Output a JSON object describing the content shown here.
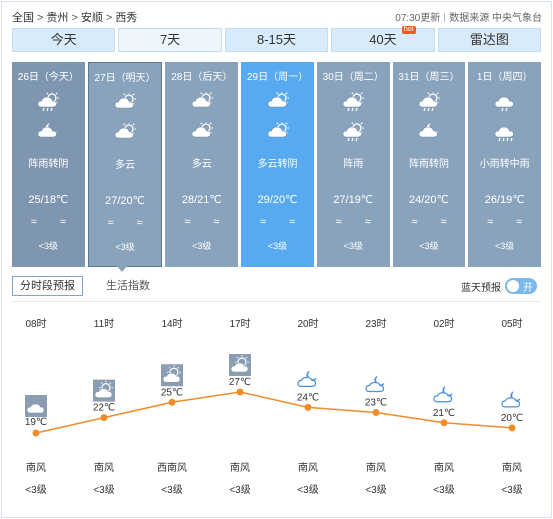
{
  "breadcrumb": {
    "items": [
      "全国",
      "贵州",
      "安顺",
      "西秀"
    ],
    "separator": ">"
  },
  "meta": {
    "update_time": "07:30更新",
    "source": "数据来源 中央气象台"
  },
  "tabs": [
    {
      "label": "今天"
    },
    {
      "label": "7天"
    },
    {
      "label": "8-15天"
    },
    {
      "label": "40天",
      "badge": "hot"
    },
    {
      "label": "雷达图"
    }
  ],
  "days": [
    {
      "date": "26日（今天）",
      "icon_day": "shower-icon",
      "icon_night": "partly-cloudy-night-icon",
      "desc": "阵雨转阴",
      "temp": "25/18℃",
      "wind_dir": "≈ ≈",
      "wind": "<3级"
    },
    {
      "date": "27日（明天）",
      "icon_day": "cloudy-icon",
      "icon_night": "cloudy-icon",
      "desc": "多云",
      "temp": "27/20℃",
      "wind_dir": "≈ ≈",
      "wind": "<3级"
    },
    {
      "date": "28日（后天）",
      "icon_day": "cloudy-icon",
      "icon_night": "cloudy-icon",
      "desc": "多云",
      "temp": "28/21℃",
      "wind_dir": "≈ ≈",
      "wind": "<3级"
    },
    {
      "date": "29日（周一）",
      "icon_day": "cloudy-icon",
      "icon_night": "cloudy-icon",
      "desc": "多云转阴",
      "temp": "29/20℃",
      "wind_dir": "≈ ≈",
      "wind": "<3级"
    },
    {
      "date": "30日（周二）",
      "icon_day": "shower-icon",
      "icon_night": "shower-icon",
      "desc": "阵雨",
      "temp": "27/19℃",
      "wind_dir": "≈ ≈",
      "wind": "<3级"
    },
    {
      "date": "31日（周三）",
      "icon_day": "shower-icon",
      "icon_night": "partly-cloudy-night-icon",
      "desc": "阵雨转阴",
      "temp": "24/20℃",
      "wind_dir": "≈ ≈",
      "wind": "<3级"
    },
    {
      "date": "1日（周四）",
      "icon_day": "light-rain-icon",
      "icon_night": "moderate-rain-icon",
      "desc": "小雨转中雨",
      "temp": "26/19℃",
      "wind_dir": "≈ ≈",
      "wind": "<3级"
    }
  ],
  "subtabs": {
    "active": "分时段预报",
    "other": "生活指数"
  },
  "toggle": {
    "label": "蓝天预报",
    "state": "开"
  },
  "hourly": [
    {
      "time": "08时",
      "icon": "overcast-icon",
      "temp": 19,
      "temp_label": "19℃",
      "wind_dir": "南风",
      "wind": "<3级"
    },
    {
      "time": "11时",
      "icon": "partly-cloudy-icon",
      "temp": 22,
      "temp_label": "22℃",
      "wind_dir": "南风",
      "wind": "<3级"
    },
    {
      "time": "14时",
      "icon": "partly-cloudy-icon",
      "temp": 25,
      "temp_label": "25℃",
      "wind_dir": "西南风",
      "wind": "<3级"
    },
    {
      "time": "17时",
      "icon": "partly-cloudy-icon",
      "temp": 27,
      "temp_label": "27℃",
      "wind_dir": "南风",
      "wind": "<3级"
    },
    {
      "time": "20时",
      "icon": "cloudy-night-icon",
      "temp": 24,
      "temp_label": "24℃",
      "wind_dir": "南风",
      "wind": "<3级"
    },
    {
      "time": "23时",
      "icon": "cloudy-night-icon",
      "temp": 23,
      "temp_label": "23℃",
      "wind_dir": "南风",
      "wind": "<3级"
    },
    {
      "time": "02时",
      "icon": "cloudy-night-icon",
      "temp": 21,
      "temp_label": "21℃",
      "wind_dir": "南风",
      "wind": "<3级"
    },
    {
      "time": "05时",
      "icon": "cloudy-night-icon",
      "temp": 20,
      "temp_label": "20℃",
      "wind_dir": "南风",
      "wind": "<3级"
    }
  ],
  "colors": {
    "tab_bg": "#d8ebfa",
    "card_bg": "#8aa3bd",
    "card_highlight": "#57a9f0",
    "line": "#f28c28",
    "toggle": "#7bb8ee",
    "hot": "#f15a22"
  }
}
